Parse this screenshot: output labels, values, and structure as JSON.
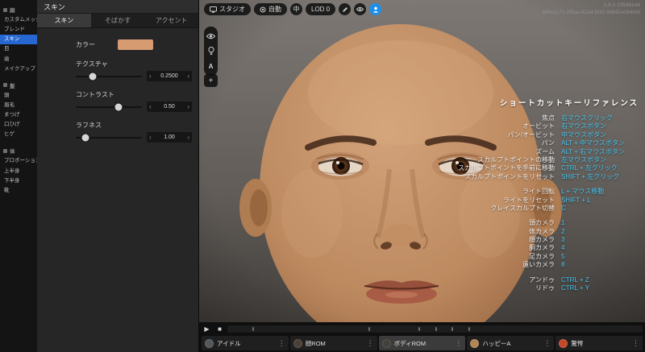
{
  "icons": {
    "chevron_left": "‹",
    "chevron_right": "›",
    "play": "▶",
    "stop": "■",
    "dots": "⋮",
    "plus": "+",
    "letter_a": "A"
  },
  "version": {
    "line1": "1.8.0 23548144",
    "line2": "a06e2c7c-1f8ae-82ad-f932-9db92e0b4f43"
  },
  "sidebar": {
    "selected_item": "スキン",
    "groups": [
      {
        "label": "顔",
        "items": [
          "カスタムメッシュ",
          "ブレンド",
          "スキン",
          "目",
          "歯",
          "メイクアップ"
        ]
      },
      {
        "label": "髪",
        "items": [
          "頭",
          "眉毛",
          "まつげ",
          "口ひげ",
          "ヒゲ"
        ]
      },
      {
        "label": "体",
        "items": [
          "プロポーション",
          "上半身",
          "下半身",
          "靴"
        ]
      }
    ]
  },
  "panel": {
    "title": "スキン",
    "active_tab": "スキン",
    "tabs": [
      "スキン",
      "そばかす",
      "アクセント"
    ],
    "controls": {
      "color": {
        "label": "カラー",
        "value": "#d79b72",
        "style": "background-color:#d79b72"
      },
      "sliders": [
        {
          "label": "テクスチャ",
          "value": "0.2500",
          "handle_style": "left:25%"
        },
        {
          "label": "コントラスト",
          "value": "0.50",
          "handle_style": "left:65%"
        },
        {
          "label": "ラフネス",
          "value": "1.00",
          "handle_style": "left:15%"
        }
      ]
    }
  },
  "toolbar": {
    "studio": "スタジオ",
    "auto": "自動",
    "quality": "中",
    "lod": "LOD 0"
  },
  "shortcuts": {
    "title": "ショートカットキーリファレンス",
    "accent_color": "#45c6f0",
    "groups": [
      [
        {
          "label": "焦点",
          "key": "右マウスクリック"
        },
        {
          "label": "オービット",
          "key": "右マウスボタン"
        },
        {
          "label": "パン/オービット",
          "key": "中マウスボタン"
        },
        {
          "label": "パン",
          "key": "ALT + 中マウスボタン"
        },
        {
          "label": "ズーム",
          "key": "ALT + 右マウスボタン"
        },
        {
          "label": "スカルプトポイントの移動",
          "key": "左マウスボタン"
        },
        {
          "label": "スカルプトポイントを手前に移動",
          "key": "CTRL + 左クリック"
        },
        {
          "label": "スカルプトポイントをリセット",
          "key": "SHIFT + 左クリック"
        }
      ],
      [
        {
          "label": "ライト回転",
          "key": "L + マウス移動"
        },
        {
          "label": "ライトをリセット",
          "key": "SHIFT + L"
        },
        {
          "label": "クレイスカルプト切替",
          "key": "C"
        }
      ],
      [
        {
          "label": "頭カメラ",
          "key": "1"
        },
        {
          "label": "体カメラ",
          "key": "2"
        },
        {
          "label": "顔カメラ",
          "key": "3"
        },
        {
          "label": "胴カメラ",
          "key": "4"
        },
        {
          "label": "足カメラ",
          "key": "5"
        },
        {
          "label": "遠いカメラ",
          "key": "8"
        }
      ],
      [
        {
          "label": "アンドゥ",
          "key": "CTRL + Z"
        },
        {
          "label": "リドゥ",
          "key": "CTRL + Y"
        }
      ]
    ]
  },
  "timeline": {
    "selected_clip": "ボディROM",
    "clips": [
      {
        "label": "アイドル",
        "thumb_style": "background:#53585d"
      },
      {
        "label": "顔ROM",
        "thumb_style": "background:#4a4038"
      },
      {
        "label": "ボディROM",
        "thumb_style": "background:#44403c"
      },
      {
        "label": "ハッピーA",
        "thumb_style": "background:#b08455"
      },
      {
        "label": "驚愕",
        "thumb_style": "background:#c4492a"
      }
    ]
  }
}
